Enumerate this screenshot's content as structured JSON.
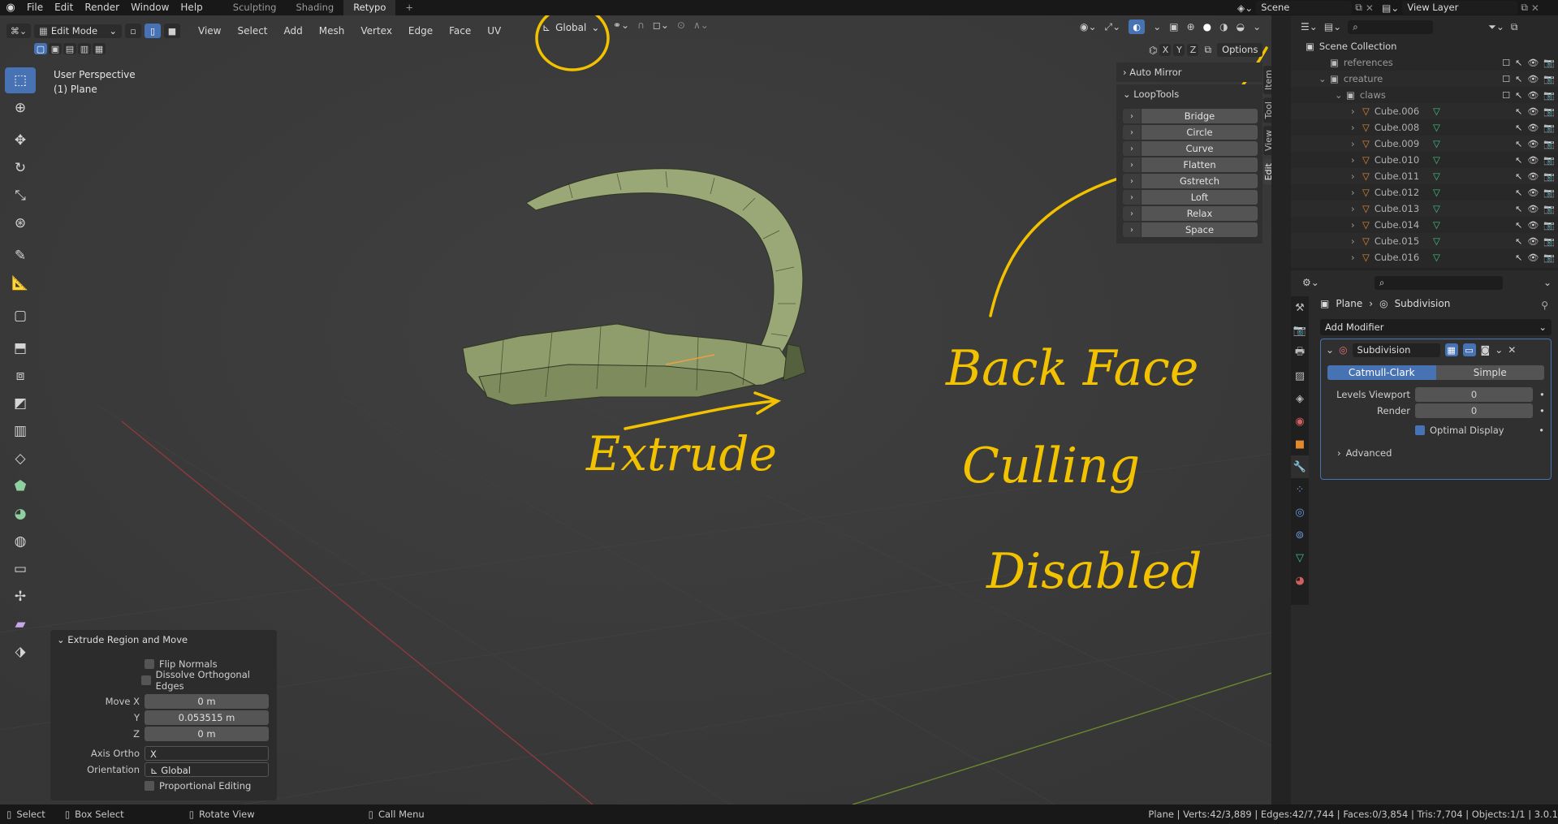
{
  "topbar": {
    "menus": [
      "File",
      "Edit",
      "Render",
      "Window",
      "Help"
    ],
    "workspaces": [
      "Sculpting",
      "Shading",
      "Retypo"
    ],
    "active_workspace": "Retypo",
    "add_tab": "+",
    "scene_label": "Scene",
    "view_layer_label": "View Layer"
  },
  "viewport": {
    "mode": "Edit Mode",
    "menus": [
      "View",
      "Select",
      "Add",
      "Mesh",
      "Vertex",
      "Edge",
      "Face",
      "UV"
    ],
    "transform_orientation": "Global",
    "axes": [
      "X",
      "Y",
      "Z"
    ],
    "options_label": "Options",
    "overlay_title": "User Perspective",
    "overlay_object": "(1) Plane"
  },
  "npanel": {
    "auto_mirror": "Auto Mirror",
    "looptools": "LoopTools",
    "buttons": [
      "Bridge",
      "Circle",
      "Curve",
      "Flatten",
      "Gstretch",
      "Loft",
      "Relax",
      "Space"
    ],
    "tabs": [
      "Item",
      "Tool",
      "View",
      "Edit"
    ],
    "active_tab": "Edit"
  },
  "redo_panel": {
    "title": "Extrude Region and Move",
    "flip_normals": "Flip Normals",
    "dissolve": "Dissolve Orthogonal Edges",
    "move_x_label": "Move X",
    "move_x": "0 m",
    "y_label": "Y",
    "y": "0.053515 m",
    "z_label": "Z",
    "z": "0 m",
    "axis_ortho_label": "Axis Ortho",
    "axis_ortho": "X",
    "orientation_label": "Orientation",
    "orientation": "Global",
    "proportional": "Proportional Editing"
  },
  "outliner": {
    "root": "Scene Collection",
    "rows": [
      {
        "label": "references",
        "indent": 1,
        "type": "collection"
      },
      {
        "label": "creature",
        "indent": 1,
        "type": "collection"
      },
      {
        "label": "claws",
        "indent": 2,
        "type": "collection"
      },
      {
        "label": "Cube.006",
        "indent": 3,
        "type": "mesh"
      },
      {
        "label": "Cube.008",
        "indent": 3,
        "type": "mesh"
      },
      {
        "label": "Cube.009",
        "indent": 3,
        "type": "mesh"
      },
      {
        "label": "Cube.010",
        "indent": 3,
        "type": "mesh"
      },
      {
        "label": "Cube.011",
        "indent": 3,
        "type": "mesh"
      },
      {
        "label": "Cube.012",
        "indent": 3,
        "type": "mesh"
      },
      {
        "label": "Cube.013",
        "indent": 3,
        "type": "mesh"
      },
      {
        "label": "Cube.014",
        "indent": 3,
        "type": "mesh"
      },
      {
        "label": "Cube.015",
        "indent": 3,
        "type": "mesh"
      },
      {
        "label": "Cube.016",
        "indent": 3,
        "type": "mesh"
      }
    ]
  },
  "properties": {
    "breadcrumb_object": "Plane",
    "breadcrumb_modifier": "Subdivision",
    "add_modifier": "Add Modifier",
    "modifier_name": "Subdivision",
    "catmull": "Catmull-Clark",
    "simple": "Simple",
    "levels_viewport_label": "Levels Viewport",
    "levels_viewport": "0",
    "render_label": "Render",
    "render": "0",
    "optimal_display": "Optimal Display",
    "advanced": "Advanced"
  },
  "annotations": {
    "extrude": "Extrude",
    "backface_1": "Back Face",
    "backface_2": "Culling",
    "backface_3": "Disabled",
    "color": "#f2c200"
  },
  "statusbar": {
    "select": "Select",
    "box_select": "Box Select",
    "rotate_view": "Rotate View",
    "call_menu": "Call Menu",
    "stats": "Plane | Verts:42/3,889 | Edges:42/7,744 | Faces:0/3,854 | Tris:7,704 | Objects:1/1 | 3.0.1"
  },
  "colors": {
    "accent": "#4772b3",
    "mesh_green": "#9aa877",
    "annotation": "#f2c200"
  }
}
